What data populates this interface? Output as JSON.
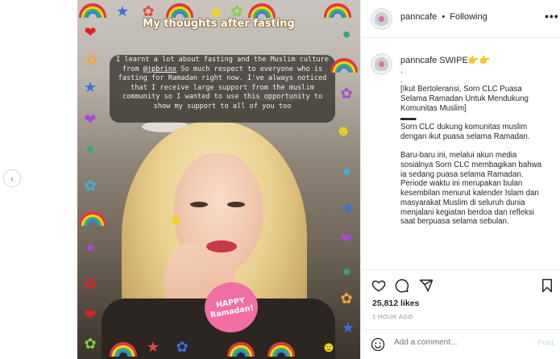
{
  "post": {
    "overlay_title": "My thoughts after fasting",
    "overlay_text_a": "I learnt a lot about fasting and the Muslim culture from ",
    "overlay_handle": "@jpbrinx",
    "overlay_text_b": " So much respect to everyone who is fasting for Ramadan right now. I've always noticed that I receive large support from the muslim community so I wanted to use this opportunity to show my support to all of you too",
    "ramadan_line1": "HAPPY",
    "ramadan_line2": "Ramadan!",
    "stickers_left": [
      "rainbow-sticker",
      "heart-sticker",
      "flower-sticker",
      "star-sticker",
      "heart-sticker",
      "globe-sticker",
      "flower-sticker",
      "rainbow-sticker",
      "globe-sticker",
      "heart-sticker",
      "heart-sticker",
      "flower-sticker"
    ],
    "stickers_right": [
      "rainbow-sticker",
      "globe-sticker",
      "rainbow-sticker",
      "flower-sticker",
      "smile-sticker",
      "globe-sticker",
      "star-sticker",
      "heart-sticker",
      "globe-sticker",
      "flower-sticker",
      "star-sticker",
      "smile-sticker"
    ]
  },
  "header": {
    "username": "panncafe",
    "separator": "•",
    "follow_status": "Following",
    "more_label": "•••"
  },
  "caption": {
    "username": "panncafe",
    "headline": "SWIPE",
    "headline_emoji": "👉👉",
    "body": ".\n.\n[Ikut Bertoleransi, Sorn CLC Puasa Selama Ramadan Untuk Mendukung Komunitas Muslim]\n▬▬\nSorn CLC dukung komunitas muslim dengan ikut puasa selama Ramadan.\n\nBaru-baru ini, melalui akun media sosialnya Sorn CLC membagikan bahwa ia sedang puasa selama Ramadan. Periode waktu ini merupakan bulan kesembilan menurut kalender Islam dan masyarakat Muslim di seluruh dunia menjalani kegiatan berdoa dan refleksi saat berpuasa selama sebulan."
  },
  "actions": {
    "likes": "25,812 likes",
    "time": "1 HOUR AGO"
  },
  "comment": {
    "placeholder": "Add a comment...",
    "post_label": "Post"
  },
  "nav": {
    "prev_glyph": "‹"
  },
  "colors": {
    "link_blue": "#0095f6",
    "post_disabled": "#b2dffc",
    "muted": "#8e8e8e"
  }
}
